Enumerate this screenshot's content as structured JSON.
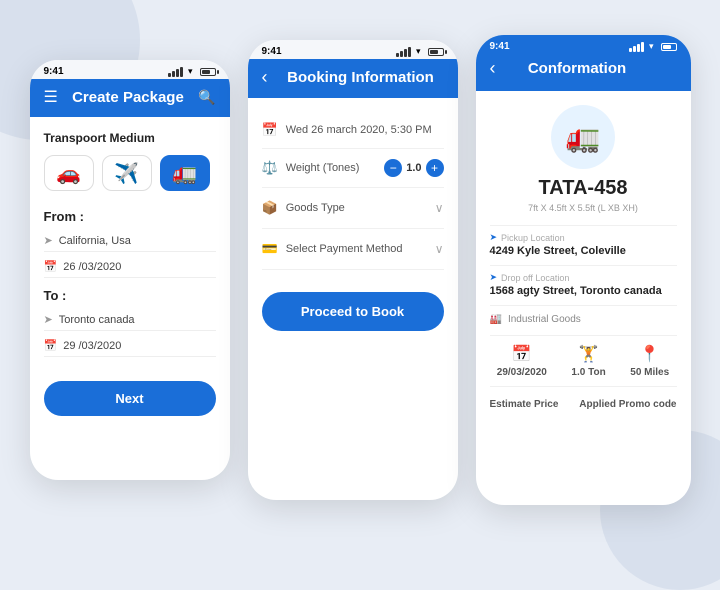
{
  "phone1": {
    "status": {
      "time": "9:41"
    },
    "header": {
      "title": "Create Package",
      "menu_label": "☰",
      "search_label": "🔍"
    },
    "transport": {
      "label": "Transpoort Medium",
      "options": [
        {
          "icon": "🚗",
          "active": false
        },
        {
          "icon": "✈️",
          "active": false
        },
        {
          "icon": "🚛",
          "active": true
        }
      ]
    },
    "from": {
      "label": "From :",
      "location": "California, Usa",
      "date": "26 /03/2020"
    },
    "to": {
      "label": "To :",
      "location": "Toronto canada",
      "date": "29 /03/2020"
    },
    "next_button": "Next"
  },
  "phone2": {
    "status": {
      "time": "9:41"
    },
    "header": {
      "title": "Booking Information",
      "back_label": "‹"
    },
    "datetime": "Wed 26 march 2020,  5:30 PM",
    "weight": {
      "label": "Weight (Tones)",
      "value": "1.0"
    },
    "goods_type": {
      "label": "Goods Type"
    },
    "payment": {
      "label": "Select Payment Method"
    },
    "proceed_button": "Proceed to Book"
  },
  "phone3": {
    "status": {
      "time": "9:41"
    },
    "header": {
      "title": "Conformation",
      "back_label": "‹"
    },
    "vehicle": {
      "id": "TATA-458",
      "dimensions": "7ft X 4.5ft X 5.5ft (L XB XH)"
    },
    "pickup": {
      "label": "Pickup Location",
      "value": "4249 Kyle Street, Coleville"
    },
    "dropoff": {
      "label": "Drop off Location",
      "value": "1568 agty Street, Toronto canada"
    },
    "goods": "Industrial Goods",
    "chips": [
      {
        "icon": "📅",
        "value": "29/03/2020"
      },
      {
        "icon": "🏋",
        "value": "1.0 Ton"
      },
      {
        "icon": "📍",
        "value": "50 Miles"
      }
    ],
    "bottom_links": {
      "estimate": "Estimate Price",
      "promo": "Applied Promo code"
    }
  }
}
